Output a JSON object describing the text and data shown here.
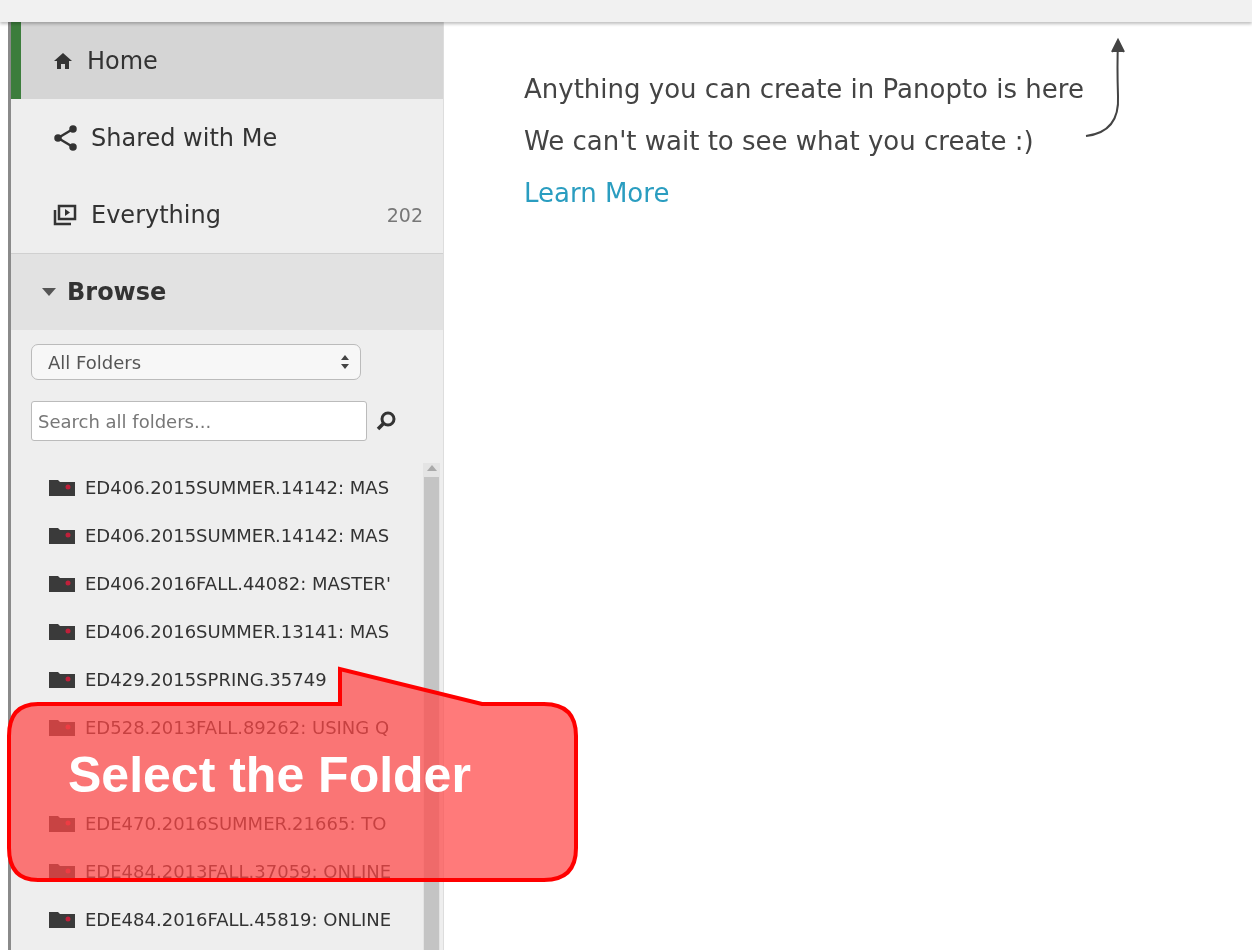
{
  "nav": [
    {
      "label": "Home",
      "kind": "home",
      "selected": true
    },
    {
      "label": "Shared with Me",
      "kind": "shared",
      "selected": false
    },
    {
      "label": "Everything",
      "kind": "everything",
      "selected": false,
      "count": "202"
    }
  ],
  "browse": {
    "title": "Browse",
    "expanded": true,
    "filter": "All Folders",
    "search": {
      "placeholder": "Search all folders..."
    }
  },
  "folders": [
    {
      "kind": "folder",
      "label": "ED406.2015SUMMER.14142: MAS"
    },
    {
      "kind": "folder",
      "label": "ED406.2015SUMMER.14142: MAS"
    },
    {
      "kind": "folder",
      "label": "ED406.2016FALL.44082: MASTER'"
    },
    {
      "kind": "folder",
      "label": "ED406.2016SUMMER.13141: MAS"
    },
    {
      "kind": "folder",
      "label": "ED429.2015SPRING.35749"
    },
    {
      "kind": "folder",
      "label": "ED528.2013FALL.89262: USING Q"
    },
    {
      "kind": "covered"
    },
    {
      "kind": "folder",
      "label": "EDE470.2016SUMMER.21665: TO"
    },
    {
      "kind": "folder",
      "label": "EDE484.2013FALL.37059: ONLINE"
    },
    {
      "kind": "folder",
      "label": "EDE484.2016FALL.45819: ONLINE"
    }
  ],
  "main": {
    "lines": [
      "Anything you can create in Panopto is here",
      "We can't wait to see what you create :)"
    ],
    "link": "Learn More"
  },
  "callout": {
    "text": "Select the Folder"
  }
}
